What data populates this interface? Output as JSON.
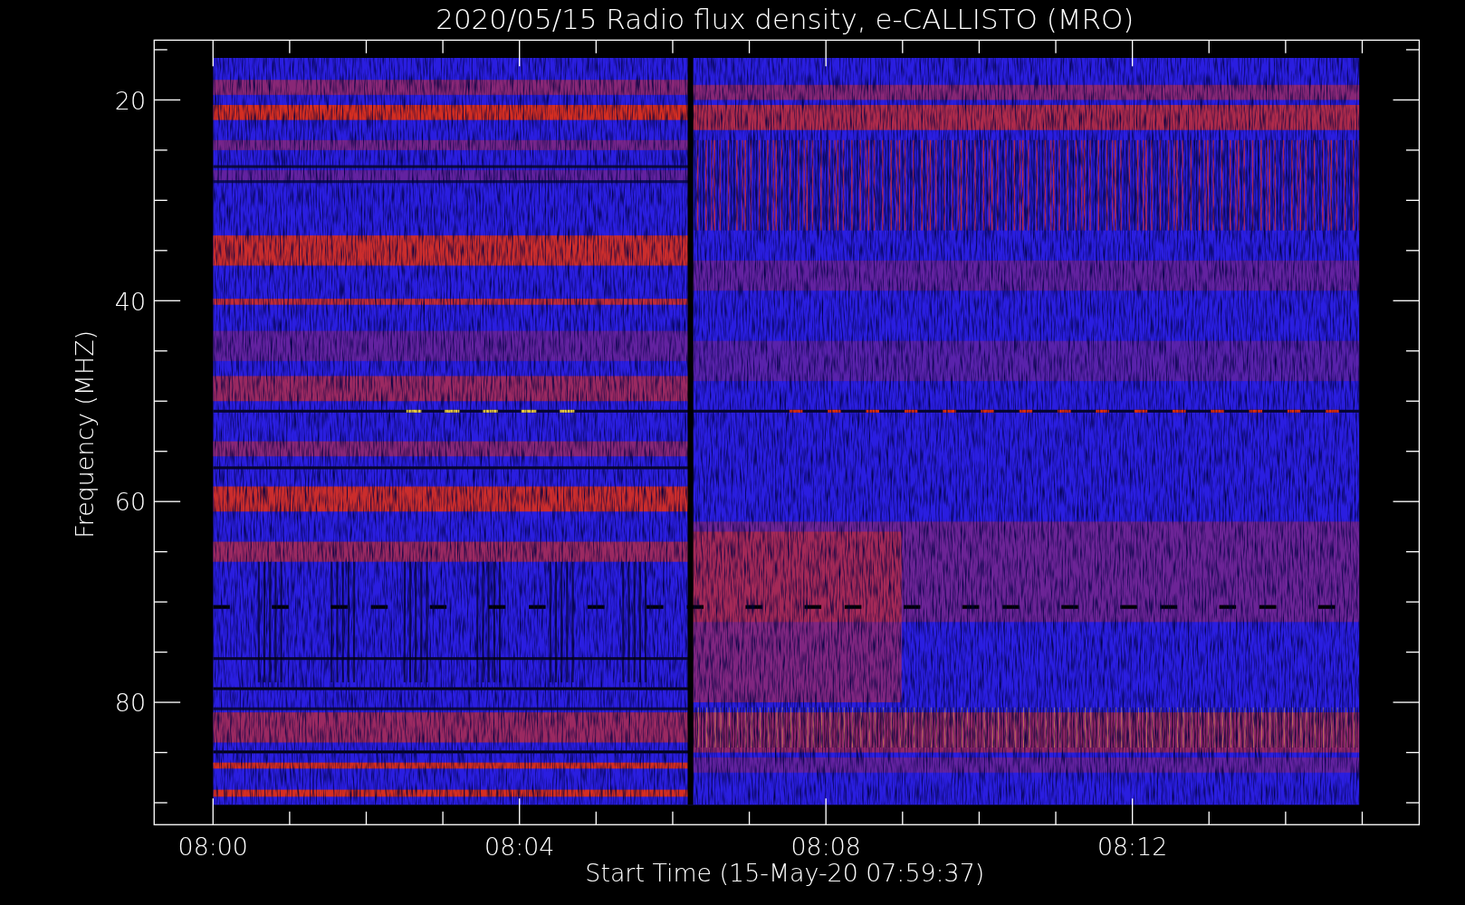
{
  "plot": {
    "title": "2020/05/15  Radio flux density, e-CALLISTO (MRO)",
    "ylabel": "Frequency (MHZ)",
    "xlabel": "Start Time (15-May-20 07:59:37)",
    "yticks": [
      "20",
      "40",
      "60",
      "80"
    ],
    "xticks": [
      "08:00",
      "08:04",
      "08:08",
      "08:12"
    ]
  }
}
